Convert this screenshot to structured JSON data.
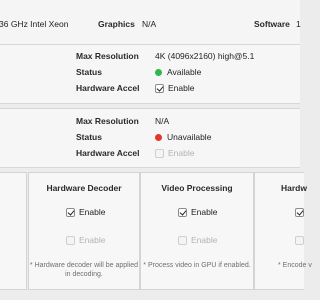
{
  "header": {
    "cpu_value": "36 GHz Intel Xeon",
    "graphics_label": "Graphics",
    "graphics_value": "N/A",
    "software_label": "Software",
    "software_value": "1"
  },
  "device1": {
    "max_res_label": "Max Resolution",
    "max_res_value": "4K (4096x2160) high@5.1",
    "status_label": "Status",
    "status_value": "Available",
    "status_color": "#2fb84a",
    "hw_accel_label": "Hardware Accel",
    "hw_accel_option": "Enable",
    "hw_accel_checked": true
  },
  "device2": {
    "max_res_label": "Max Resolution",
    "max_res_value": "N/A",
    "status_label": "Status",
    "status_value": "Unavailable",
    "status_color": "#e5342b",
    "hw_accel_label": "Hardware Accel",
    "hw_accel_option": "Enable",
    "hw_accel_checked": false
  },
  "columns": [
    {
      "title": "Hardware Decoder",
      "enable_checked_label": "Enable",
      "enable_disabled_label": "Enable",
      "note": "* Hardware decoder will be applied in decoding."
    },
    {
      "title": "Video Processing",
      "enable_checked_label": "Enable",
      "enable_disabled_label": "Enable",
      "note": "* Process video in GPU if enabled."
    },
    {
      "title": "Hardw",
      "note": "* Encode v"
    }
  ]
}
